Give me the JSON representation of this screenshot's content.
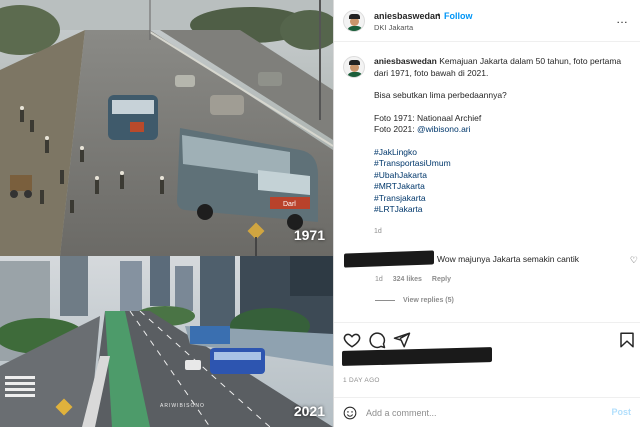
{
  "photo": {
    "label_top": "1971",
    "label_bottom": "2021",
    "watermark": "ARIWIBISONO",
    "bus_sign": "Darl",
    "building_sign": "Transjakarta"
  },
  "header": {
    "username": "aniesbaswedan",
    "separator": "•",
    "follow_label": "Follow",
    "location": "DKI Jakarta",
    "more_icon": "more-dots-icon",
    "more_label": "…"
  },
  "caption": {
    "username": "aniesbaswedan",
    "text": "Kemajuan Jakarta dalam 50 tahun, foto pertama dari 1971, foto bawah di 2021.",
    "question": "Bisa sebutkan lima perbedaannya?",
    "credit_1971": "Foto 1971: Nationaal Archief",
    "credit_2021_prefix": "Foto 2021: ",
    "credit_2021_handle": "@wibisono.ari",
    "hashtags": [
      "#JakLingko",
      "#TransportasiUmum",
      "#UbahJakarta",
      "#MRTJakarta",
      "#Transjakarta",
      "#LRTJakarta"
    ],
    "age": "1d"
  },
  "comment": {
    "text": "Wow majunya Jakarta semakin cantik",
    "age": "1d",
    "likes": "324 likes",
    "reply_label": "Reply",
    "view_replies": "View replies (5)"
  },
  "post": {
    "date": "1 DAY AGO"
  },
  "add_comment": {
    "placeholder": "Add a comment...",
    "post_label": "Post"
  },
  "colors": {
    "accent": "#0095f6",
    "link": "#00376b",
    "muted": "#8e8e8e",
    "post_disabled": "#b2dffc"
  }
}
